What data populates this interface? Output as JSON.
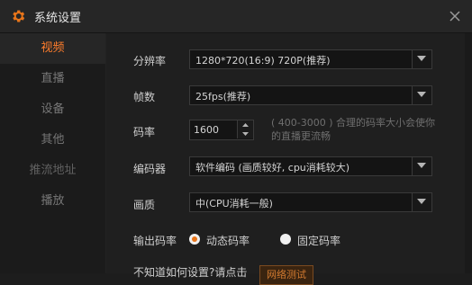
{
  "window": {
    "title": "系统设置"
  },
  "sidebar": {
    "items": [
      {
        "label": "视频",
        "state": "active"
      },
      {
        "label": "直播",
        "state": "normal"
      },
      {
        "label": "设备",
        "state": "normal"
      },
      {
        "label": "其他",
        "state": "normal"
      },
      {
        "label": "推流地址",
        "state": "disabled"
      },
      {
        "label": "播放",
        "state": "normal"
      }
    ]
  },
  "video": {
    "resolution": {
      "label": "分辨率",
      "value": "1280*720(16:9) 720P(推荐)"
    },
    "framerate": {
      "label": "帧数",
      "value": "25fps(推荐)"
    },
    "bitrate": {
      "label": "码率",
      "value": "1600",
      "hint": "( 400-3000 ) 合理的码率大小会使你的直播更流畅"
    },
    "encoder": {
      "label": "编码器",
      "value": "软件编码 (画质较好, cpu消耗较大)"
    },
    "quality": {
      "label": "画质",
      "value": "中(CPU消耗一般)"
    },
    "output_bitrate": {
      "label": "输出码率",
      "options": [
        {
          "label": "动态码率",
          "selected": true
        },
        {
          "label": "固定码率",
          "selected": false
        }
      ]
    },
    "network_test": {
      "label": "不知道如何设置?请点击",
      "button": "网络测试"
    }
  },
  "colors": {
    "accent": "#ff7d2c",
    "background": "#1d1d1d",
    "panel": "#262626"
  },
  "icons": {
    "app": "gear-icon",
    "close": "close-icon",
    "dropdown": "chevron-down-icon"
  }
}
